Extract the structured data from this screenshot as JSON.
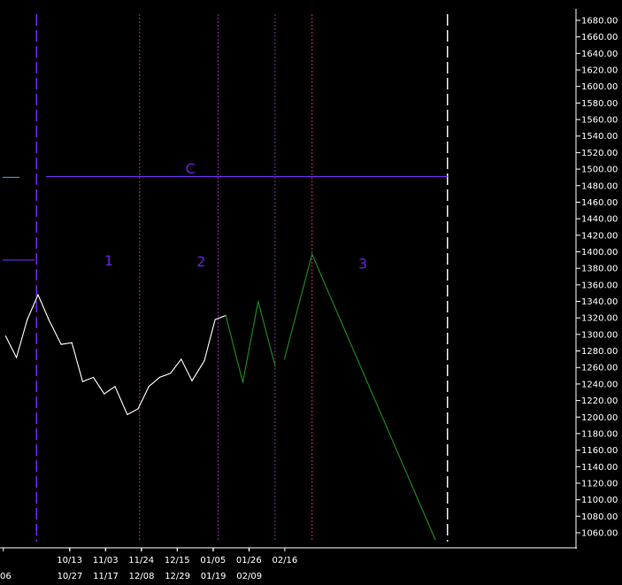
{
  "chart_data": {
    "type": "line",
    "y_axis_side": "right",
    "ylim": [
      1042,
      1692
    ],
    "y_ticks": [
      1680,
      1660,
      1640,
      1620,
      1600,
      1580,
      1560,
      1540,
      1520,
      1500,
      1480,
      1460,
      1440,
      1420,
      1400,
      1380,
      1360,
      1340,
      1320,
      1300,
      1280,
      1260,
      1240,
      1220,
      1200,
      1180,
      1160,
      1140,
      1120,
      1100,
      1080,
      1060
    ],
    "y_tick_labels": [
      "1680.00",
      "1660.00",
      "1640.00",
      "1620.00",
      "1600.00",
      "1580.00",
      "1560.00",
      "1540.00",
      "1520.00",
      "1500.00",
      "1480.00",
      "1460.00",
      "1440.00",
      "1420.00",
      "1400.00",
      "1380.00",
      "1360.00",
      "1340.00",
      "1320.00",
      "1300.00",
      "1280.00",
      "1260.00",
      "1240.00",
      "1220.00",
      "1200.00",
      "1180.00",
      "1160.00",
      "1140.00",
      "1120.00",
      "1100.00",
      "1080.00",
      "1060.00"
    ],
    "x_tick_rows": [
      [
        "10/13",
        "11/03",
        "11/24",
        "12/15",
        "01/05",
        "01/26",
        "02/16"
      ],
      [
        "06",
        "10/27",
        "11/17",
        "12/08",
        "12/29",
        "01/19",
        "02/09"
      ]
    ],
    "series": [
      {
        "color": "#ffffff",
        "points": [
          [
            -1.7,
            1298
          ],
          [
            -1.0,
            1272
          ],
          [
            -0.3,
            1318
          ],
          [
            0.4,
            1348
          ],
          [
            1.1,
            1318
          ],
          [
            1.9,
            1288
          ],
          [
            2.6,
            1290
          ],
          [
            3.3,
            1243
          ],
          [
            4.0,
            1248
          ],
          [
            4.7,
            1228
          ],
          [
            5.4,
            1237
          ],
          [
            6.2,
            1203
          ],
          [
            6.9,
            1210
          ],
          [
            7.6,
            1237
          ],
          [
            8.3,
            1248
          ],
          [
            9.0,
            1253
          ],
          [
            9.7,
            1270
          ],
          [
            10.4,
            1244
          ],
          [
            11.2,
            1268
          ],
          [
            11.9,
            1318
          ],
          [
            12.6,
            1323
          ]
        ]
      },
      {
        "color": "#1f8f1f",
        "points": [
          [
            12.6,
            1323
          ],
          [
            13.7,
            1242
          ],
          [
            14.7,
            1340
          ],
          [
            15.8,
            1262
          ]
        ]
      },
      {
        "color": "#1f8f1f",
        "points": [
          [
            16.4,
            1270
          ],
          [
            18.2,
            1397
          ],
          [
            26.2,
            1052
          ]
        ]
      }
    ],
    "horizontal_lines": [
      {
        "y": 1490,
        "x_start": -1.9,
        "x_end": -0.8,
        "color": "#5aa0ff"
      },
      {
        "y": 1390,
        "x_start": -1.9,
        "x_end": 0.2,
        "color": "#7a2cff"
      },
      {
        "y": 1491,
        "x_start": 0.9,
        "x_end": 27.0,
        "color": "#7a2cff"
      }
    ],
    "vertical_lines": [
      {
        "x": 0.3,
        "color": "#7a2cff",
        "style": "long-dash"
      },
      {
        "x": 7.0,
        "color": "#c0304a",
        "style": "dotted"
      },
      {
        "x": 12.1,
        "color": "#8a2a9a",
        "style": "dotted"
      },
      {
        "x": 15.8,
        "color": "#8a2a9a",
        "style": "dotted"
      },
      {
        "x": 18.2,
        "color": "#c0304a",
        "style": "dotted"
      },
      {
        "x": 27.0,
        "color": "#ffffff",
        "style": "long-dash"
      }
    ],
    "annotations": [
      {
        "text": "C",
        "x": 10.3,
        "y": 1501
      },
      {
        "text": "1",
        "x": 5.0,
        "y": 1390
      },
      {
        "text": "2",
        "x": 11.0,
        "y": 1389
      },
      {
        "text": "3",
        "x": 21.5,
        "y": 1386
      }
    ],
    "wave_color": "#6a1fd8",
    "grid": false,
    "legend": "none",
    "background": "#000000"
  }
}
